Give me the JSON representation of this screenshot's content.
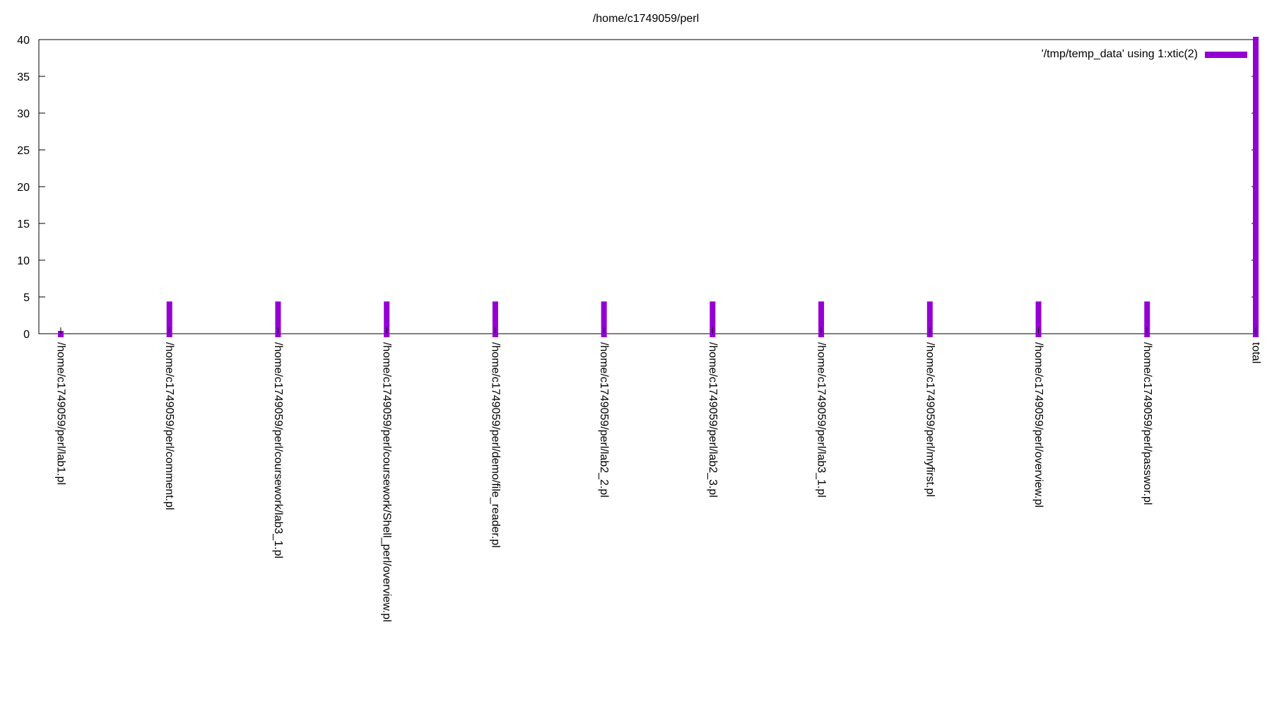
{
  "chart_data": {
    "type": "bar",
    "title": "/home/c1749059/perl",
    "xlabel": "",
    "ylabel": "",
    "ylim": [
      0,
      40
    ],
    "yticks": [
      "0",
      "5",
      "10",
      "15",
      "20",
      "25",
      "30",
      "35",
      "40"
    ],
    "grid": false,
    "legend_position": "top-right",
    "categories": [
      "/home/c1749059/perl/lab1.pl",
      "/home/c1749059/perl/comment.pl",
      "/home/c1749059/perl/coursework/lab3_1.pl",
      "/home/c1749059/perl/coursework/Shell_perl/overview.pl",
      "/home/c1749059/perl/demo/file_reader.pl",
      "/home/c1749059/perl/lab2_2.pl",
      "/home/c1749059/perl/lab2_3.pl",
      "/home/c1749059/perl/lab3_1.pl",
      "/home/c1749059/perl/myfirst.pl",
      "/home/c1749059/perl/overview.pl",
      "/home/c1749059/perl/passwor.pl",
      "total"
    ],
    "series": [
      {
        "name": "'/tmp/temp_data' using 1:xtic(2)",
        "color": "#9400d3",
        "values": [
          0,
          4,
          4,
          4,
          4,
          4,
          4,
          4,
          4,
          4,
          4,
          40
        ]
      }
    ]
  }
}
